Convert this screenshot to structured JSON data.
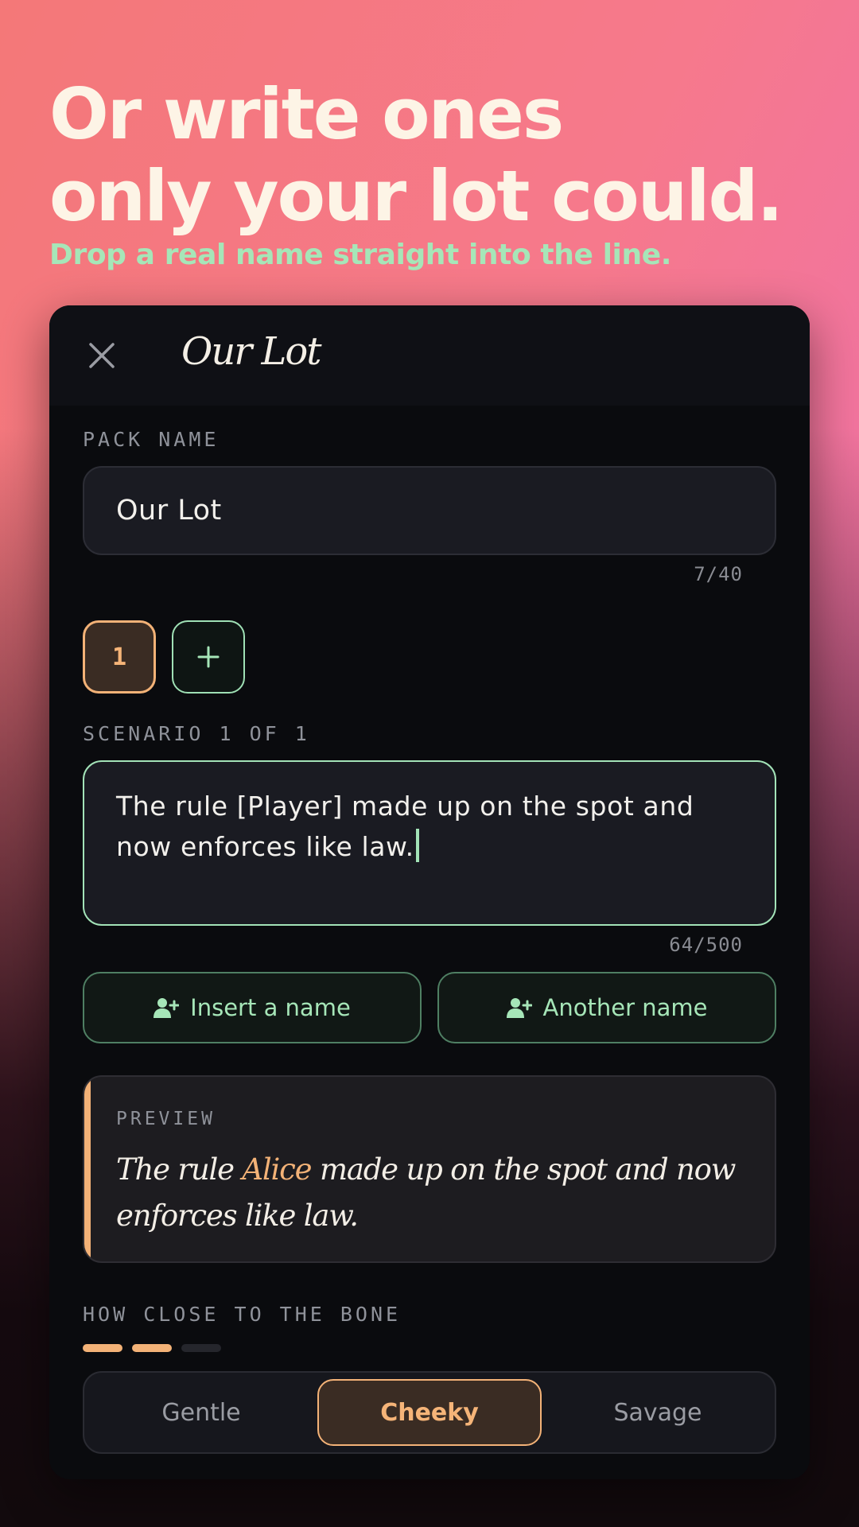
{
  "hero": {
    "line1": "Or write ones",
    "line2": "only your lot could.",
    "subtitle": "Drop a real name straight into the line."
  },
  "header": {
    "close_icon": "close-icon",
    "title": "Our Lot"
  },
  "pack_name": {
    "label": "PACK NAME",
    "value": "Our Lot",
    "counter": "7/40"
  },
  "scenarios": {
    "chips": [
      "1"
    ],
    "add_icon": "plus-icon",
    "label": "SCENARIO 1 OF 1",
    "text": "The rule [Player] made up on the spot and now enforces like law.",
    "counter": "64/500"
  },
  "name_buttons": {
    "icon": "person-add-icon",
    "insert_label": "Insert a name",
    "another_label": "Another name"
  },
  "preview": {
    "label": "PREVIEW",
    "before": "The rule ",
    "name": "Alice",
    "after": " made up on the spot and now enforces like law.",
    "accent_color": "#f3b277"
  },
  "intensity": {
    "label": "HOW CLOSE TO THE BONE",
    "level": 2,
    "max": 3,
    "options": [
      "Gentle",
      "Cheeky",
      "Savage"
    ],
    "selected": "Cheeky"
  },
  "colors": {
    "accent_green": "#a3e3b8",
    "accent_orange": "#f3b277",
    "card_bg": "#0a0b0e"
  }
}
